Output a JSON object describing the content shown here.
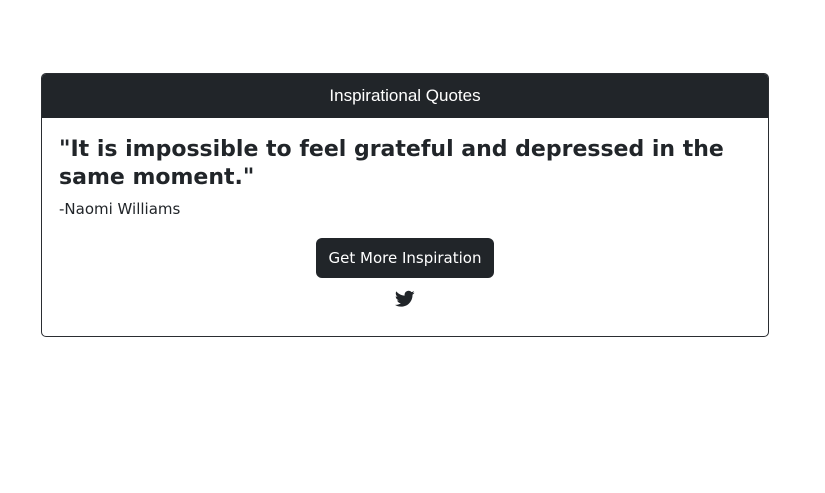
{
  "card": {
    "header_title": "Inspirational Quotes",
    "quote_text": "\"It is impossible to feel grateful and depressed in the same moment.\"",
    "author": "-Naomi Williams",
    "button_label": "Get More Inspiration",
    "share_icon": "twitter-icon"
  },
  "colors": {
    "header_bg": "#212529",
    "button_bg": "#212529",
    "text": "#212529"
  }
}
